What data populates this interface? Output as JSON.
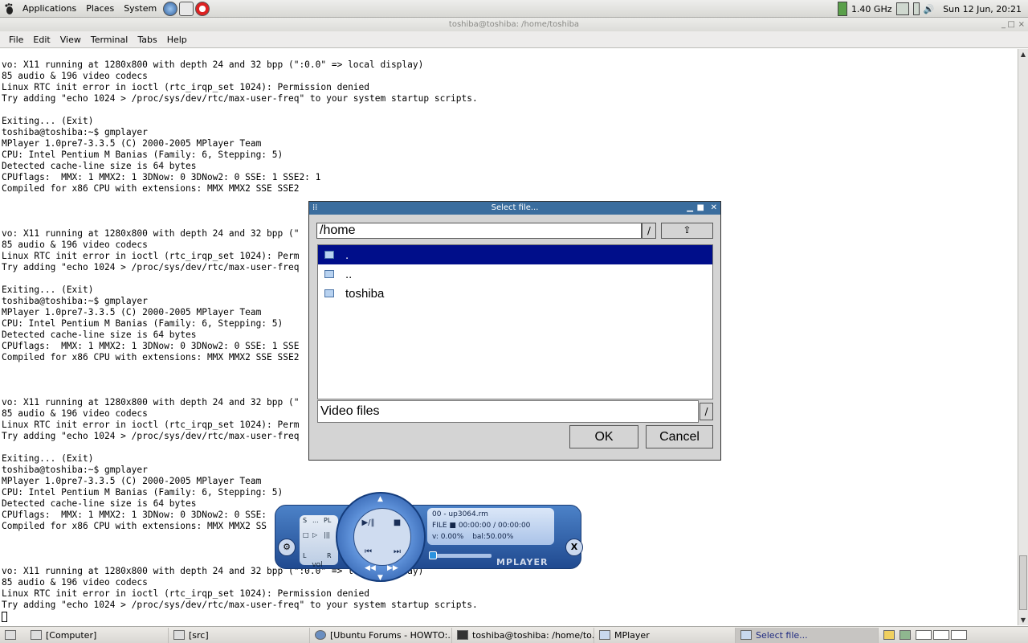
{
  "top_panel": {
    "menus": [
      "Applications",
      "Places",
      "System"
    ],
    "cpu_freq": "1.40 GHz",
    "clock": "Sun 12 Jun, 20:21"
  },
  "terminal": {
    "title": "toshiba@toshiba: /home/toshiba",
    "menus": [
      "File",
      "Edit",
      "View",
      "Terminal",
      "Tabs",
      "Help"
    ],
    "lines": [
      "vo: X11 running at 1280x800 with depth 24 and 32 bpp (\":0.0\" => local display)",
      "85 audio & 196 video codecs",
      "Linux RTC init error in ioctl (rtc_irqp_set 1024): Permission denied",
      "Try adding \"echo 1024 > /proc/sys/dev/rtc/max-user-freq\" to your system startup scripts.",
      "",
      "Exiting... (Exit)",
      "toshiba@toshiba:~$ gmplayer",
      "MPlayer 1.0pre7-3.3.5 (C) 2000-2005 MPlayer Team",
      "CPU: Intel Pentium M Banias (Family: 6, Stepping: 5)",
      "Detected cache-line size is 64 bytes",
      "CPUflags:  MMX: 1 MMX2: 1 3DNow: 0 3DNow2: 0 SSE: 1 SSE2: 1",
      "Compiled for x86 CPU with extensions: MMX MMX2 SSE SSE2",
      "",
      "",
      "",
      "vo: X11 running at 1280x800 with depth 24 and 32 bpp (\"",
      "85 audio & 196 video codecs",
      "Linux RTC init error in ioctl (rtc_irqp_set 1024): Perm",
      "Try adding \"echo 1024 > /proc/sys/dev/rtc/max-user-freq",
      "",
      "Exiting... (Exit)",
      "toshiba@toshiba:~$ gmplayer",
      "MPlayer 1.0pre7-3.3.5 (C) 2000-2005 MPlayer Team",
      "CPU: Intel Pentium M Banias (Family: 6, Stepping: 5)",
      "Detected cache-line size is 64 bytes",
      "CPUflags:  MMX: 1 MMX2: 1 3DNow: 0 3DNow2: 0 SSE: 1 SSE",
      "Compiled for x86 CPU with extensions: MMX MMX2 SSE SSE2",
      "",
      "",
      "",
      "vo: X11 running at 1280x800 with depth 24 and 32 bpp (\"",
      "85 audio & 196 video codecs",
      "Linux RTC init error in ioctl (rtc_irqp_set 1024): Perm",
      "Try adding \"echo 1024 > /proc/sys/dev/rtc/max-user-freq",
      "",
      "Exiting... (Exit)",
      "toshiba@toshiba:~$ gmplayer",
      "MPlayer 1.0pre7-3.3.5 (C) 2000-2005 MPlayer Team",
      "CPU: Intel Pentium M Banias (Family: 6, Stepping: 5)",
      "Detected cache-line size is 64 bytes",
      "CPUflags:  MMX: 1 MMX2: 1 3DNow: 0 3DNow2: 0 SSE:",
      "Compiled for x86 CPU with extensions: MMX MMX2 SS",
      "",
      "",
      "",
      "vo: X11 running at 1280x800 with depth 24 and 32 bpp (\":0.0\" => local display)",
      "85 audio & 196 video codecs",
      "Linux RTC init error in ioctl (rtc_irqp_set 1024): Permission denied",
      "Try adding \"echo 1024 > /proc/sys/dev/rtc/max-user-freq\" to your system startup scripts."
    ]
  },
  "file_dialog": {
    "title": "Select file...",
    "path": "/home",
    "path_button": "/",
    "entries": [
      ".",
      "..",
      "toshiba"
    ],
    "selected": ".",
    "filter": "Video files",
    "ok_label": "OK",
    "cancel_label": "Cancel"
  },
  "mplayer": {
    "track": "00  -  up3064.rm",
    "file_label": "FILE",
    "time": "00:00:00 / 00:00:00",
    "volume_readout": "v:  0.00%",
    "balance_readout": "bal:50.00%",
    "brand": "MPLAYER",
    "vol_label": "vol",
    "mini_buttons": [
      "S",
      "...",
      "PL"
    ],
    "balance_left": "L",
    "balance_right": "R"
  },
  "taskbar": {
    "items": [
      "[Computer]",
      "[src]",
      "[Ubuntu Forums - HOWTO:...",
      "toshiba@toshiba: /home/to...",
      "MPlayer",
      "Select file..."
    ],
    "active": "Select file..."
  }
}
